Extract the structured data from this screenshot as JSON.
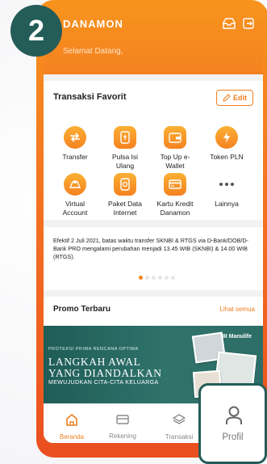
{
  "app": {
    "brand": "DANAMON",
    "greeting": "Selamat Datang,"
  },
  "step_badge": "2",
  "favorites": {
    "title": "Transaksi Favorit",
    "edit_label": "Edit",
    "items": [
      {
        "label": "Transfer",
        "icon": "transfer-icon"
      },
      {
        "label": "Pulsa Isi Ulang",
        "icon": "phone-credit-icon"
      },
      {
        "label": "Top Up e-Wallet",
        "icon": "wallet-icon"
      },
      {
        "label": "Token PLN",
        "icon": "lightning-icon"
      },
      {
        "label": "Virtual Account",
        "icon": "virtual-account-icon"
      },
      {
        "label": "Paket Data Internet",
        "icon": "data-package-icon"
      },
      {
        "label": "Kartu Kredit Danamon",
        "icon": "credit-card-icon"
      },
      {
        "label": "Lainnya",
        "icon": "more-icon"
      }
    ]
  },
  "notice": {
    "text": "Efektif 2 Juli 2021, batas waktu transfer SKNBI & RTGS via D-Bank/DOB/D-Bank PRO mengalami perubahan menjadi 13.45 WIB (SKNBI) & 14.00 WIB (RTGS).",
    "pages": 6,
    "active_page": 1
  },
  "promo": {
    "title": "Promo Terbaru",
    "link": "Lihat semua",
    "banner": {
      "small": "PROTEKSI PRIMA RENCANA OPTIMA",
      "line1": "LANGKAH AWAL",
      "line2": "YANG DIANDALKAN",
      "sub": "MEWUJUDKAN CITA-CITA KELUARGA",
      "brand": "Manulife"
    }
  },
  "bottom_nav": {
    "items": [
      {
        "label": "Beranda",
        "icon": "home-icon",
        "active": true
      },
      {
        "label": "Rekening",
        "icon": "card-icon",
        "active": false
      },
      {
        "label": "Transaksi",
        "icon": "layers-icon",
        "active": false
      }
    ]
  },
  "profil_popup": {
    "label": "Profil",
    "icon": "person-icon"
  },
  "colors": {
    "accent": "#f58220",
    "badge": "#245c58",
    "banner": "#2f736b"
  }
}
